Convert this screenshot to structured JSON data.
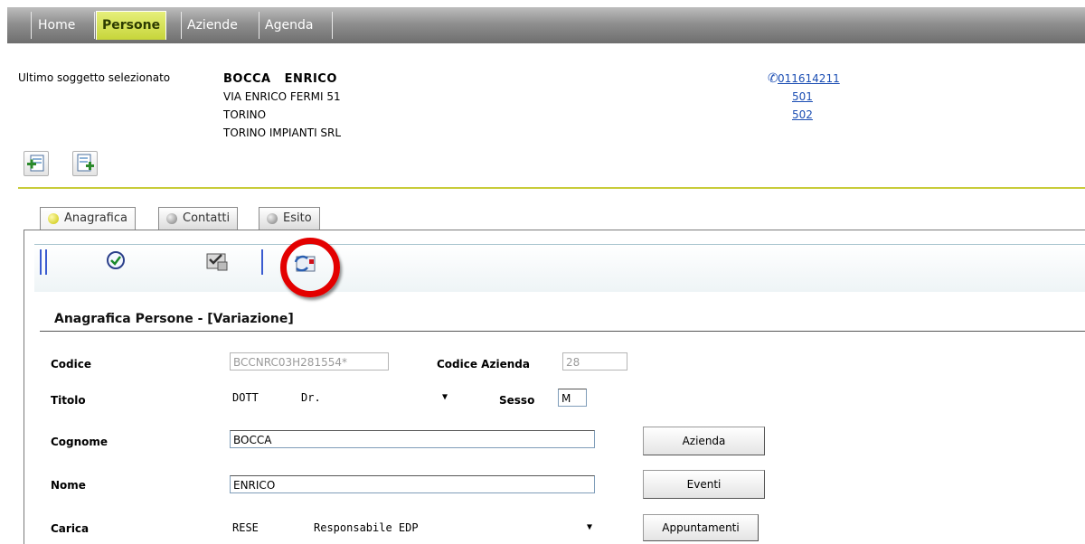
{
  "nav": {
    "tabs": [
      {
        "label": "Home",
        "active": false
      },
      {
        "label": "Persone",
        "active": true
      },
      {
        "label": "Aziende",
        "active": false
      },
      {
        "label": "Agenda",
        "active": false
      }
    ]
  },
  "subject": {
    "label": "Ultimo soggetto selezionato",
    "name": "BOCCA   ENRICO",
    "address": "VIA ENRICO FERMI 51",
    "city": "TORINO",
    "company": "TORINO IMPIANTI SRL",
    "phones": [
      "011614211",
      "501",
      "502"
    ]
  },
  "toolbar_icons": [
    "add-record-icon",
    "edit-record-icon"
  ],
  "tabs": [
    {
      "label": "Anagrafica",
      "dot_color": "#c9c400"
    },
    {
      "label": "Contatti",
      "dot_color": "#8a8a8a"
    },
    {
      "label": "Esito",
      "dot_color": "#8a8a8a"
    }
  ],
  "inner_toolbar": {
    "icons": [
      "confirm-check-icon",
      "checked-form-icon",
      "refresh-record-icon"
    ],
    "highlight_color": "#e30000"
  },
  "form": {
    "title": "Anagrafica Persone - [Variazione]",
    "codice": {
      "label": "Codice",
      "value": "BCCNRC03H281554*"
    },
    "codice_azienda": {
      "label": "Codice Azienda",
      "value": "28"
    },
    "titolo": {
      "label": "Titolo",
      "code": "DOTT",
      "text": "Dr."
    },
    "sesso": {
      "label": "Sesso",
      "value": "M"
    },
    "cognome": {
      "label": "Cognome",
      "value": "BOCCA"
    },
    "nome": {
      "label": "Nome",
      "value": "ENRICO"
    },
    "carica": {
      "label": "Carica",
      "code": "RESE",
      "text": "Responsabile EDP"
    },
    "buttons": {
      "azienda": "Azienda",
      "eventi": "Eventi",
      "appuntamenti": "Appuntamenti"
    }
  }
}
